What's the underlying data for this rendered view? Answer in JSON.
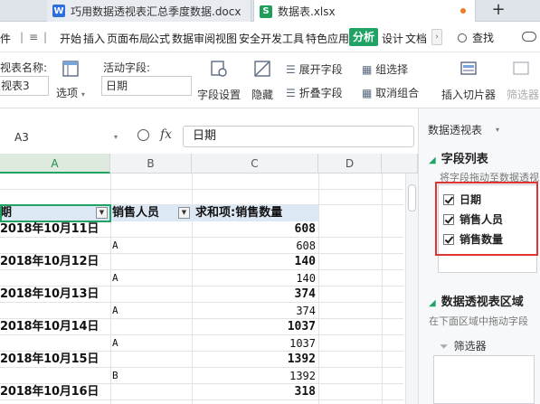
{
  "tabs": {
    "docx_name": "巧用数据透视表汇总季度数据.docx",
    "xlsx_name": "数据表.xlsx",
    "new_tab": "+",
    "docx_icon": "W",
    "xlsx_icon": "S",
    "close_glyph": "×"
  },
  "menu": {
    "file_label": "件",
    "items": [
      "开始",
      "插入",
      "页面布局",
      "公式",
      "数据",
      "审阅",
      "视图",
      "安全",
      "开发工具",
      "特色应用"
    ],
    "active_label": "分析",
    "after_active": [
      "设计",
      "文档"
    ],
    "find_label": "查找"
  },
  "ribbon": {
    "pivot_name_label": "视表名称:",
    "pivot_name_value": "视表3",
    "options_label": "选项",
    "active_field_label": "活动字段:",
    "active_field_value": "日期",
    "field_settings_label": "字段设置",
    "hide_label": "隐藏",
    "expand_label": "展开字段",
    "collapse_label": "折叠字段",
    "group_label": "组选择",
    "ungroup_label": "取消组合",
    "slicer_label": "插入切片器",
    "filter_conn_label": "筛选器"
  },
  "formula_bar": {
    "cell_ref": "A3",
    "fx": "fx",
    "value": "日期"
  },
  "sheet": {
    "columns": [
      "A",
      "B",
      "C",
      "D"
    ],
    "pivot_headers": {
      "date": "期",
      "person": "销售人员",
      "sum": "求和项:销售数量"
    },
    "rows": [
      {
        "kind": "date",
        "date": "2018年10月11日",
        "value": "608"
      },
      {
        "kind": "detail",
        "person": "A",
        "value": "608"
      },
      {
        "kind": "date",
        "date": "2018年10月12日",
        "value": "140"
      },
      {
        "kind": "detail",
        "person": "A",
        "value": "140"
      },
      {
        "kind": "date",
        "date": "2018年10月13日",
        "value": "374"
      },
      {
        "kind": "detail",
        "person": "A",
        "value": "374"
      },
      {
        "kind": "date",
        "date": "2018年10月14日",
        "value": "1037"
      },
      {
        "kind": "detail",
        "person": "A",
        "value": "1037"
      },
      {
        "kind": "date",
        "date": "2018年10月15日",
        "value": "1392"
      },
      {
        "kind": "detail",
        "person": "B",
        "value": "1392"
      },
      {
        "kind": "date",
        "date": "2018年10月16日",
        "value": "318"
      }
    ]
  },
  "pane": {
    "title": "数据透视表",
    "field_list_title": "字段列表",
    "field_list_hint": "将字段拖动至数据透视",
    "fields": [
      {
        "label": "日期",
        "checked": true
      },
      {
        "label": "销售人员",
        "checked": true
      },
      {
        "label": "销售数量",
        "checked": true
      }
    ],
    "area_title": "数据透视表区域",
    "area_hint": "在下面区域中拖动字段",
    "filter_label": "筛选器"
  },
  "colors": {
    "accent_green": "#21a366",
    "highlight_red": "#e03333",
    "pivot_header_bg": "#dde8f5"
  }
}
